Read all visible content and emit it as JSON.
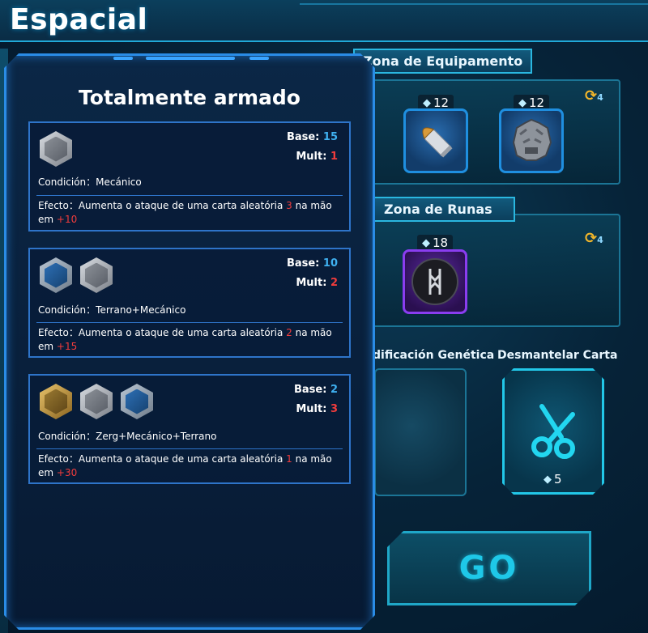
{
  "header": {
    "title": "Espacial"
  },
  "equipment_zone": {
    "label": "Zona de Equipamento",
    "refresh_count": "4",
    "items": [
      {
        "name": "bullet",
        "price": "12"
      },
      {
        "name": "skull-helmet",
        "price": "12"
      }
    ]
  },
  "rune_zone": {
    "label": "Zona de Runas",
    "refresh_count": "4",
    "items": [
      {
        "name": "rune-disc",
        "price": "18"
      }
    ]
  },
  "genetic": {
    "label": "dificación Genética"
  },
  "dismantle": {
    "label": "Desmantelar Carta",
    "price": "5"
  },
  "go_button": {
    "label": "GO"
  },
  "modal": {
    "title": "Totalmente armado",
    "combos": [
      {
        "icons": [
          "silver"
        ],
        "base_label": "Base:",
        "base_value": "15",
        "mult_label": "Mult:",
        "mult_value": "1",
        "condition": "Condición：Mecánico",
        "effect_prefix": "Efecto：Aumenta o ataque de uma carta aleatória ",
        "effect_count": "3",
        "effect_mid": " na mão em ",
        "effect_bonus": "+10"
      },
      {
        "icons": [
          "blue",
          "silver"
        ],
        "base_label": "Base:",
        "base_value": "10",
        "mult_label": "Mult:",
        "mult_value": "2",
        "condition": "Condición：Terrano+Mecánico",
        "effect_prefix": "Efecto：Aumenta o ataque de uma carta aleatória ",
        "effect_count": "2",
        "effect_mid": " na mão em ",
        "effect_bonus": "+15"
      },
      {
        "icons": [
          "gold",
          "silver",
          "blue"
        ],
        "base_label": "Base:",
        "base_value": "2",
        "mult_label": "Mult:",
        "mult_value": "3",
        "condition": "Condición：Zerg+Mecánico+Terrano",
        "effect_prefix": "Efecto：Aumenta o ataque de uma carta aleatória ",
        "effect_count": "1",
        "effect_mid": " na mão em ",
        "effect_bonus": "+30"
      }
    ]
  },
  "colors": {
    "accent_cyan": "#1ec8e8",
    "modal_border": "#2a8ce6",
    "value_cyan": "#3fb0f0",
    "value_red": "#f03c3c",
    "refresh_gold": "#f2b62a"
  }
}
